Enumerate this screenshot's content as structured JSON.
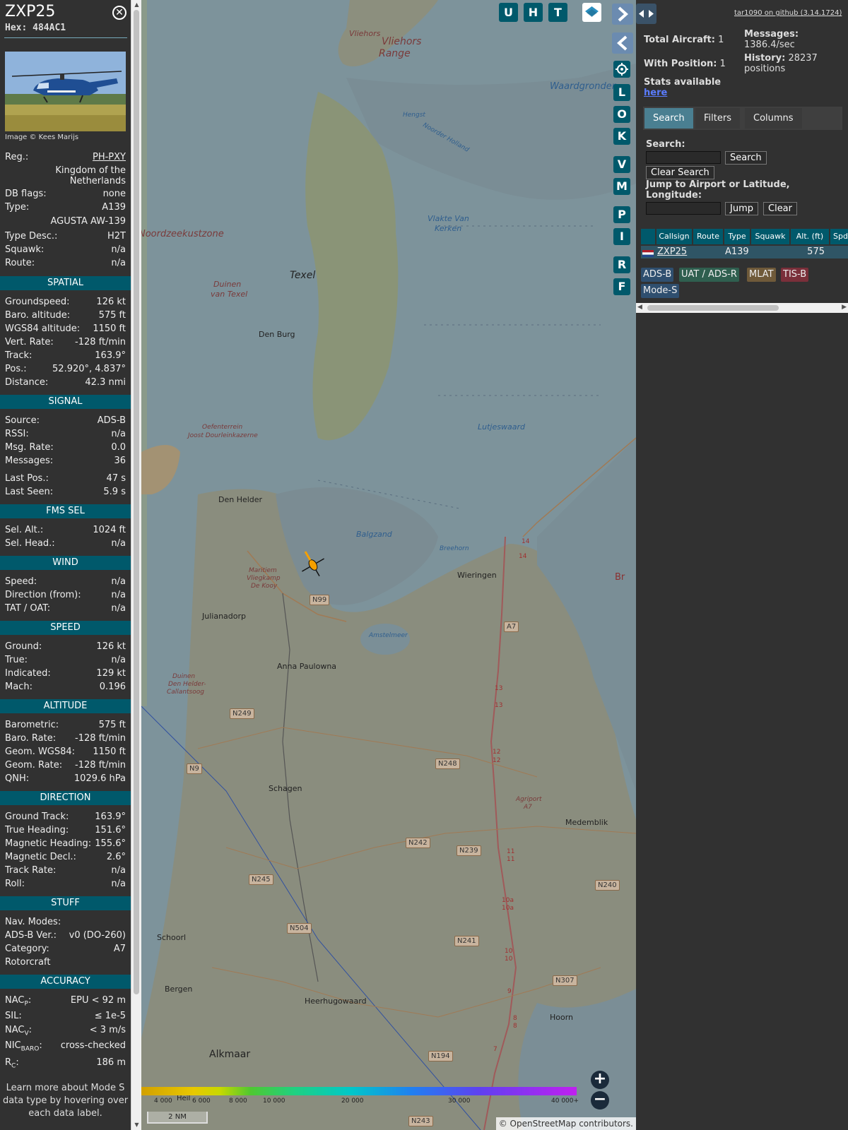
{
  "aircraft": {
    "callsign": "ZXP25",
    "hex_label": "Hex:",
    "hex": "484AC1",
    "close_icon": "close-icon",
    "photo_credit": "Image © Kees Marijs"
  },
  "info": {
    "reg_label": "Reg.:",
    "reg": "PH-PXY",
    "country_line1": "Kingdom of the",
    "country_line2": "Netherlands",
    "dbflags_label": "DB flags:",
    "dbflags": "none",
    "type_label": "Type:",
    "type": "A139",
    "type_name": "AGUSTA AW-139",
    "typedesc_label": "Type Desc.:",
    "typedesc": "H2T",
    "squawk_label": "Squawk:",
    "squawk": "n/a",
    "route_label": "Route:",
    "route": "n/a"
  },
  "spatial": {
    "title": "SPATIAL",
    "gs_label": "Groundspeed:",
    "gs": "126 kt",
    "baro_label": "Baro. altitude:",
    "baro": "575 ft",
    "wgs_label": "WGS84 altitude:",
    "wgs": "1150 ft",
    "vr_label": "Vert. Rate:",
    "vr": "-128 ft/min",
    "track_label": "Track:",
    "track": "163.9°",
    "pos_label": "Pos.:",
    "pos": "52.920°, 4.837°",
    "dist_label": "Distance:",
    "dist": "42.3 nmi"
  },
  "signal": {
    "title": "SIGNAL",
    "src_label": "Source:",
    "src": "ADS-B",
    "rssi_label": "RSSI:",
    "rssi": "n/a",
    "msgrate_label": "Msg. Rate:",
    "msgrate": "0.0",
    "msgs_label": "Messages:",
    "msgs": "36",
    "lastpos_label": "Last Pos.:",
    "lastpos": "47 s",
    "lastseen_label": "Last Seen:",
    "lastseen": "5.9 s"
  },
  "fms": {
    "title": "FMS SEL",
    "selalt_label": "Sel. Alt.:",
    "selalt": "1024 ft",
    "selhead_label": "Sel. Head.:",
    "selhead": "n/a"
  },
  "wind": {
    "title": "WIND",
    "speed_label": "Speed:",
    "speed": "n/a",
    "dir_label": "Direction (from):",
    "dir": "n/a",
    "tat_label": "TAT / OAT:",
    "tat": "n/a"
  },
  "speed": {
    "title": "SPEED",
    "ground_label": "Ground:",
    "ground": "126 kt",
    "true_label": "True:",
    "true": "n/a",
    "ind_label": "Indicated:",
    "ind": "129 kt",
    "mach_label": "Mach:",
    "mach": "0.196"
  },
  "altitude": {
    "title": "ALTITUDE",
    "baro_label": "Barometric:",
    "baro": "575 ft",
    "barorate_label": "Baro. Rate:",
    "barorate": "-128 ft/min",
    "geom_label": "Geom. WGS84:",
    "geom": "1150 ft",
    "geomrate_label": "Geom. Rate:",
    "geomrate": "-128 ft/min",
    "qnh_label": "QNH:",
    "qnh": "1029.6 hPa"
  },
  "direction": {
    "title": "DIRECTION",
    "gt_label": "Ground Track:",
    "gt": "163.9°",
    "th_label": "True Heading:",
    "th": "151.6°",
    "mh_label": "Magnetic Heading:",
    "mh": "155.6°",
    "md_label": "Magnetic Decl.:",
    "md": "2.6°",
    "tr_label": "Track Rate:",
    "tr": "n/a",
    "roll_label": "Roll:",
    "roll": "n/a"
  },
  "stuff": {
    "title": "STUFF",
    "nav_label": "Nav. Modes:",
    "nav": "",
    "adsb_label": "ADS-B Ver.:",
    "adsb": "v0 (DO-260)",
    "cat_label": "Category:",
    "cat": "A7",
    "cat_desc": "Rotorcraft"
  },
  "accuracy": {
    "title": "ACCURACY",
    "nacp_label": "NAC",
    "nacp_sub": "P",
    "nacp": "EPU < 92 m",
    "sil_label": "SIL:",
    "sil": "≤ 1e-5",
    "nacv_label": "NAC",
    "nacv_sub": "V",
    "nacv": "< 3 m/s",
    "nicbaro_label": "NIC",
    "nicbaro_sub": "BARO",
    "nicbaro": "cross-checked",
    "rc_label": "R",
    "rc_sub": "C",
    "rc": "186 m"
  },
  "footnote": "Learn more about Mode S data type by hovering over each data label.",
  "map": {
    "buttons_top": [
      "U",
      "H",
      "T"
    ],
    "buttons_side": [
      "L",
      "O",
      "K",
      "V",
      "M",
      "P",
      "I",
      "R",
      "F"
    ],
    "labels": {
      "vliehors": "Vliehors",
      "vliehors_range": "Vliehors",
      "range": "Range",
      "waardgronden": "Waardgronden",
      "hengst": "Hengst",
      "noorder": "Noorder Holland",
      "noordzee": "Noordzeekustzone",
      "vlakte1": "Vlakte Van",
      "vlakte2": "Kerken",
      "texel": "Texel",
      "duinen1": "Duinen",
      "duinen2": "van Texel",
      "denburg": "Den Burg",
      "oefen1": "Oefenterrein",
      "oefen2": "Joost Dourleinkazerne",
      "lutjes": "Lutjeswaard",
      "denhelder": "Den Helder",
      "balgzand": "Balgzand",
      "breehorn": "Breehorn",
      "wieringen": "Wieringen",
      "maritiem1": "Maritiem",
      "maritiem2": "Vliegkamp",
      "maritiem3": "De Kooy",
      "julianadorp": "Julianadorp",
      "amstelmeer": "Amstelmeer",
      "anna": "Anna Paulowna",
      "duinenhd1": "Duinen",
      "duinenhd2": "Den Helder-",
      "duinenhd3": "Callantsoog",
      "schagen": "Schagen",
      "agriport1": "Agriport",
      "agriport2": "A7",
      "medemblik": "Medemblik",
      "schoorl": "Schoorl",
      "bergen": "Bergen",
      "heerhugowaard": "Heerhugowaard",
      "hoorn": "Hoorn",
      "alkmaar": "Alkmaar",
      "heil": "Heil",
      "br": "Br"
    },
    "roads": {
      "n99": "N99",
      "a7": "A7",
      "n249": "N249",
      "n9": "N9",
      "n248": "N248",
      "n242": "N242",
      "n239": "N239",
      "n245": "N245",
      "n504": "N504",
      "n241": "N241",
      "n240": "N240",
      "n307": "N307",
      "n194": "N194",
      "n243": "N243"
    },
    "exits": [
      "14",
      "14",
      "13",
      "13",
      "12",
      "12",
      "11",
      "11",
      "10a",
      "10a",
      "10",
      "10",
      "9",
      "8",
      "8",
      "7"
    ],
    "color_scale": [
      "4 000",
      "6 000",
      "8 000",
      "10 000",
      "20 000",
      "30 000",
      "40 000+"
    ],
    "scale_bar": "2 NM",
    "attribution_prefix": "© ",
    "attribution_link": "OpenStreetMap",
    "attribution_suffix": " contributors."
  },
  "panel": {
    "github": "tar1090 on github (3.14.1724)",
    "total_label": "Total Aircraft:",
    "total": "1",
    "withpos_label": "With Position:",
    "withpos": "1",
    "stats_label": "Stats available",
    "stats_link": "here",
    "msgs_label": "Messages:",
    "msgs": "1386.4/sec",
    "history_label": "History:",
    "history": "28237",
    "history_unit": "positions",
    "tabs": [
      "Search",
      "Filters",
      "Columns"
    ],
    "search_label": "Search:",
    "search_btn": "Search",
    "clear_search_btn": "Clear Search",
    "jump_label": "Jump to Airport or Latitude, Longitude:",
    "jump_btn": "Jump",
    "clear_btn": "Clear",
    "columns": [
      "Callsign",
      "Route",
      "Type",
      "Squawk",
      "Alt. (ft)",
      "Spd."
    ],
    "row": {
      "callsign": "ZXP25",
      "route": "",
      "type": "A139",
      "squawk": "",
      "alt": "575"
    },
    "chips": [
      "ADS-B",
      "UAT / ADS-R",
      "MLAT",
      "TIS-B",
      "Mode-S"
    ],
    "colors": {
      "accent": "#00596b",
      "adsb": "#2f4f6f",
      "uat": "#2f5f4f",
      "mlat": "#6f5a3a",
      "tisb": "#7a2f3a",
      "modes": "#2f4f6f"
    }
  }
}
